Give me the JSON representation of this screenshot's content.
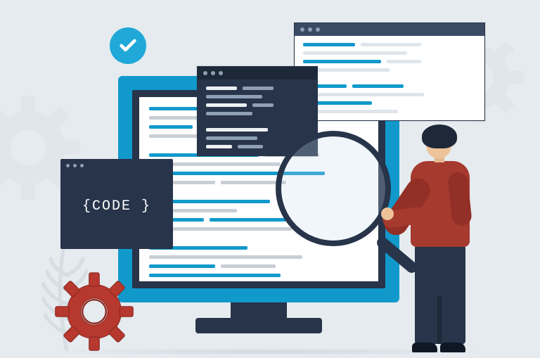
{
  "code_card": {
    "label": "{CODE }"
  },
  "colors": {
    "accent_blue": "#1199cc",
    "dark_navy": "#27344a",
    "red_gear": "#b7382e",
    "person_shirt": "#a63a2f",
    "background": "#e6ebef"
  },
  "icons": {
    "checkmark": "check",
    "magnifier": "magnifying-glass",
    "gear_large": "gear",
    "gear_bg_left": "gear",
    "gear_bg_right": "gear"
  }
}
